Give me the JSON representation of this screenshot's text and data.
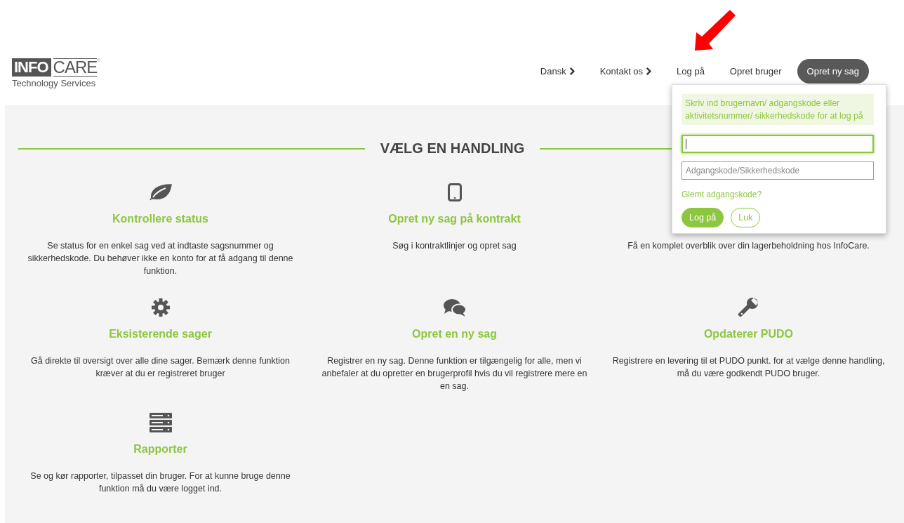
{
  "logo": {
    "brand_left": "INFO",
    "brand_right": "CARE",
    "mark": "®",
    "tagline": "Technology Services"
  },
  "nav": [
    {
      "label": "Dansk",
      "kind": "dropdown"
    },
    {
      "label": "Kontakt os",
      "kind": "dropdown"
    },
    {
      "label": "Log på",
      "kind": "link"
    },
    {
      "label": "Opret bruger",
      "kind": "link"
    },
    {
      "label": "Opret ny sag",
      "kind": "pill"
    }
  ],
  "login_popup": {
    "message": "Skriv ind brugernavn/ adgangskode eller aktivitetsnummer/ sikkerhedskode for at log på",
    "fields": [
      {
        "focused": true
      },
      {
        "placeholder": "Adgangskode/Sikkerhedskode",
        "focused": false
      }
    ],
    "forgot_link": "Glemt adgangskode?",
    "buttons": [
      {
        "label": "Log på",
        "kind": "primary"
      },
      {
        "label": "Luk",
        "kind": "outline"
      }
    ]
  },
  "section_title": "VÆLG EN HANDLING",
  "cards": [
    {
      "title": "Kontrollere status",
      "description": "Se status for en enkel sag ved at indtaste sagsnummer og sikkerhedskode. Du behøver ikke en konto for at få adgang til denne funktion."
    },
    {
      "title": "Opret ny sag på kontrakt",
      "description": "Søg i kontraktlinjer og opret sag"
    },
    {
      "description": "Få en komplet overblik over din lagerbeholdning hos InfoCare."
    },
    {
      "title": "Eksisterende sager",
      "description": "Gå direkte til oversigt over alle dine sager. Bemærk denne funktion kræver at du er registreret bruger"
    },
    {
      "title": "Opret en ny sag",
      "description": "Registrer en ny sag. Denne funktion er tilgængelig for alle, men vi anbefaler at du opretter en brugerprofil hvis du vil registrere mere en en sag."
    },
    {
      "title": "Opdaterer PUDO",
      "description": "Registrere en levering til et PUDO punkt. for at vælge denne handling, må du være godkendt PUDO bruger."
    },
    {
      "title": "Rapporter",
      "description": "Se og kør rapporter, tilpasset din bruger. For at kunne bruge denne funktion må du være logget ind."
    }
  ]
}
